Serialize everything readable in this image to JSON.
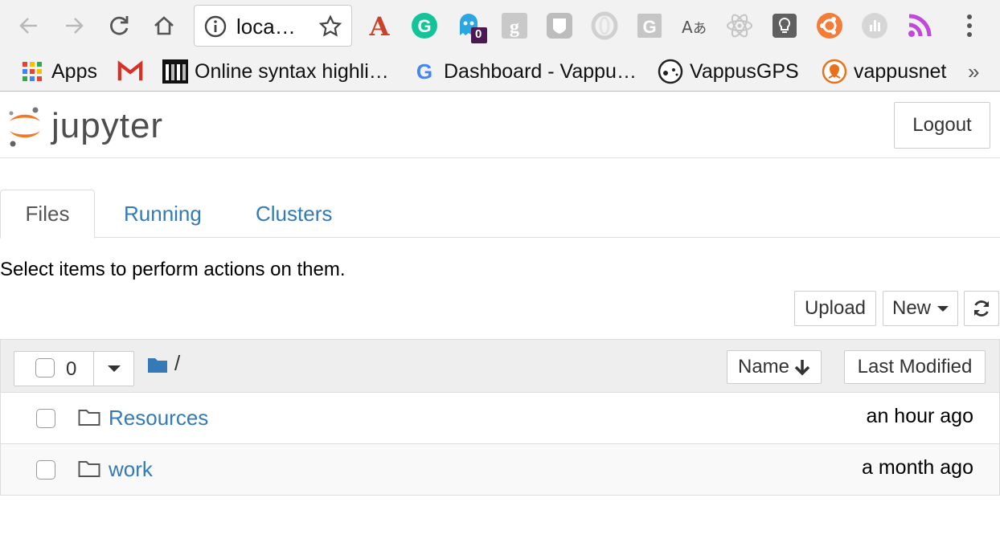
{
  "browser": {
    "address_text": "loca…",
    "extensions": [
      "font-a-icon",
      "grammarly-icon",
      "ghostery-icon",
      "google-plus-icon",
      "shield-ext-icon",
      "opera-ext-icon",
      "g-ext-icon",
      "translate-icon",
      "react-devtools-icon",
      "bulb-ext-icon",
      "ubuntu-ext-icon",
      "analytics-ext-icon",
      "rss-icon"
    ],
    "ghostery_badge": "0",
    "bookmarks": [
      {
        "label": "Apps",
        "icon": "apps-grid-icon"
      },
      {
        "label": "",
        "icon": "gmail-icon"
      },
      {
        "label": "Online syntax highli…",
        "icon": "syntax-highlight-icon"
      },
      {
        "label": "Dashboard - Vappu…",
        "icon": "google-icon"
      },
      {
        "label": "VappusGPS",
        "icon": "gps-icon"
      },
      {
        "label": "vappusnet",
        "icon": "vappusnet-icon"
      }
    ],
    "more_bookmarks": "»"
  },
  "header": {
    "logo_text": "jupyter",
    "logout_label": "Logout"
  },
  "tabs": [
    {
      "label": "Files",
      "active": true
    },
    {
      "label": "Running",
      "active": false
    },
    {
      "label": "Clusters",
      "active": false
    }
  ],
  "hint": "Select items to perform actions on them.",
  "actions": {
    "upload_label": "Upload",
    "new_label": "New"
  },
  "list": {
    "selected_count": "0",
    "breadcrumb": "/",
    "sort_name_label": "Name",
    "sort_modified_label": "Last Modified",
    "items": [
      {
        "name": "Resources",
        "modified": "an hour ago",
        "type": "folder"
      },
      {
        "name": "work",
        "modified": "a month ago",
        "type": "folder"
      }
    ]
  },
  "colors": {
    "link": "#337ab7",
    "jupyter_orange": "#f37726"
  }
}
